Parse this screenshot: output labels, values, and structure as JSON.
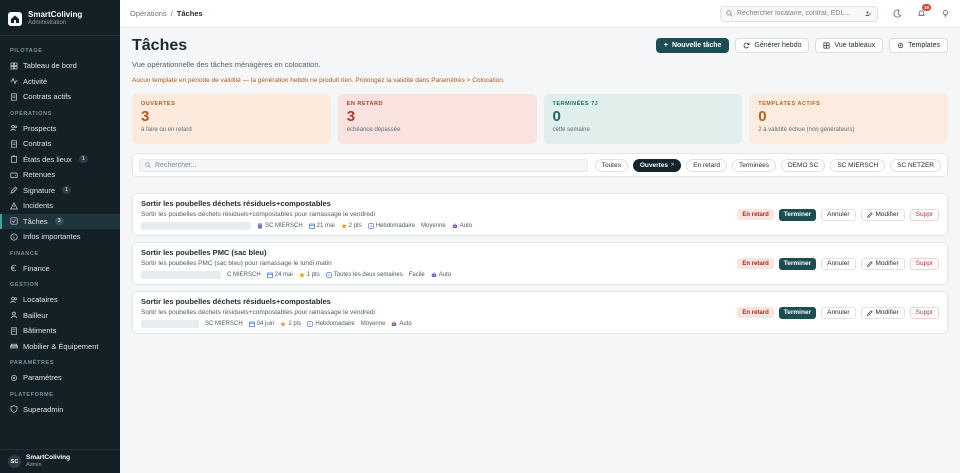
{
  "brand": {
    "name": "SmartColiving",
    "subtitle": "Administration"
  },
  "sidebar": {
    "sections": [
      {
        "title": "PILOTAGE",
        "items": [
          {
            "label": "Tableau de bord",
            "icon": "dashboard-icon"
          },
          {
            "label": "Activité",
            "icon": "activity-icon"
          },
          {
            "label": "Contrats actifs",
            "icon": "contract-icon"
          }
        ]
      },
      {
        "title": "OPÉRATIONS",
        "items": [
          {
            "label": "Prospects",
            "icon": "users-icon"
          },
          {
            "label": "Contrats",
            "icon": "contract-icon"
          },
          {
            "label": "États des lieux",
            "icon": "clipboard-icon",
            "badge": "1"
          },
          {
            "label": "Retenues",
            "icon": "wallet-icon"
          },
          {
            "label": "Signature",
            "icon": "pen-icon",
            "badge": "1"
          },
          {
            "label": "Incidents",
            "icon": "alert-icon"
          },
          {
            "label": "Tâches",
            "icon": "check-icon",
            "badge": "3",
            "active": true
          },
          {
            "label": "Infos importantes",
            "icon": "info-icon"
          }
        ]
      },
      {
        "title": "FINANCE",
        "items": [
          {
            "label": "Finance",
            "icon": "euro-icon"
          }
        ]
      },
      {
        "title": "GESTION",
        "items": [
          {
            "label": "Locataires",
            "icon": "users-icon"
          },
          {
            "label": "Bailleur",
            "icon": "user-icon"
          },
          {
            "label": "Bâtiments",
            "icon": "building-icon"
          },
          {
            "label": "Mobilier & Équipement",
            "icon": "sofa-icon"
          }
        ]
      },
      {
        "title": "PARAMÈTRES",
        "items": [
          {
            "label": "Paramètres",
            "icon": "gear-icon"
          }
        ]
      },
      {
        "title": "PLATEFORME",
        "items": [
          {
            "label": "Superadmin",
            "icon": "shield-icon"
          }
        ]
      }
    ],
    "user": {
      "initials": "SC",
      "name": "SmartColiving",
      "role": "Admin"
    }
  },
  "topbar": {
    "breadcrumb": [
      "Opérations",
      "/",
      "Tâches"
    ],
    "search_placeholder": "Rechercher locataire, contrat, EDL...",
    "notifications": "19"
  },
  "page": {
    "title": "Tâches",
    "subtitle": "Vue opérationnelle des tâches ménagères en colocation.",
    "warning": "Aucun template en période de validité — la génération hebdo ne produit rien. Prolongez la validité dans Paramètres > Colocation.",
    "actions": {
      "new_task": "Nouvelle tâche",
      "generate": "Générer hebdo",
      "tables": "Vue tableaux",
      "templates": "Templates"
    }
  },
  "stats": [
    {
      "label": "OUVERTES",
      "value": "3",
      "desc": "à faire ou en retard",
      "color": "#b25a1f"
    },
    {
      "label": "EN RETARD",
      "value": "3",
      "desc": "échéance dépassée",
      "color": "#b23a2c"
    },
    {
      "label": "TERMINÉES 7J",
      "value": "0",
      "desc": "cette semaine",
      "color": "#1e6a63"
    },
    {
      "label": "TEMPLATES ACTIFS",
      "value": "0",
      "desc": "2 à validité échue (non générateurs)",
      "color": "#b2651f"
    }
  ],
  "filters": {
    "search_placeholder": "Rechercher...",
    "chips": [
      {
        "label": "Toutes"
      },
      {
        "label": "Ouvertes",
        "active": true,
        "close": "×"
      },
      {
        "label": "En retard"
      },
      {
        "label": "Terminées"
      },
      {
        "label": "DEMO SC"
      },
      {
        "label": "SC MIERSCH"
      },
      {
        "label": "SC NETZER"
      }
    ]
  },
  "tasks": [
    {
      "title": "Sortir les poubelles déchets résiduels+compostables",
      "desc": "Sortir les poubelles déchets résiduels+compostables pour ramassage le vendredi",
      "meta": [
        {
          "icon": "building-icon",
          "text": "SC MIERSCH"
        },
        {
          "icon": "calendar-icon",
          "text": "21 mai"
        },
        {
          "icon": "star-icon",
          "text": "2 pts"
        },
        {
          "icon": "repeat-icon",
          "text": "Hebdomadaire"
        },
        {
          "icon": "",
          "text": "Moyenne"
        },
        {
          "icon": "robot-icon",
          "text": "Auto"
        }
      ],
      "badge": "En retard"
    },
    {
      "title": "Sortir les poubelles PMC (sac bleu)",
      "desc": "Sortir les poubelles PMC (sac bleu) pour ramassage le lundi matin",
      "meta": [
        {
          "icon": "",
          "text": "C MIERSCH"
        },
        {
          "icon": "calendar-icon",
          "text": "24 mai"
        },
        {
          "icon": "star-icon",
          "text": "1 pts"
        },
        {
          "icon": "repeat-icon",
          "text": "Toutes les deux semaines"
        },
        {
          "icon": "",
          "text": "Facile"
        },
        {
          "icon": "robot-icon",
          "text": "Auto"
        }
      ],
      "badge": "En retard"
    },
    {
      "title": "Sortir les poubelles déchets résiduels+compostables",
      "desc": "Sortir les poubelles déchets résiduels+compostables pour ramassage le vendredi",
      "meta": [
        {
          "icon": "",
          "text": "SC MIERSCH"
        },
        {
          "icon": "calendar-icon",
          "text": "04 juin"
        },
        {
          "icon": "star-icon",
          "text": "2 pts"
        },
        {
          "icon": "repeat-icon",
          "text": "Hebdomadaire"
        },
        {
          "icon": "",
          "text": "Moyenne"
        },
        {
          "icon": "robot-icon",
          "text": "Auto"
        }
      ],
      "badge": "En retard"
    }
  ],
  "task_actions": {
    "finish": "Terminer",
    "cancel": "Annuler",
    "edit": "Modifier",
    "delete": "Suppr"
  },
  "colors": {
    "primary": "#1b4d52",
    "sidebar": "#132127",
    "danger": "#c0362c",
    "warning": "#b45a18"
  }
}
